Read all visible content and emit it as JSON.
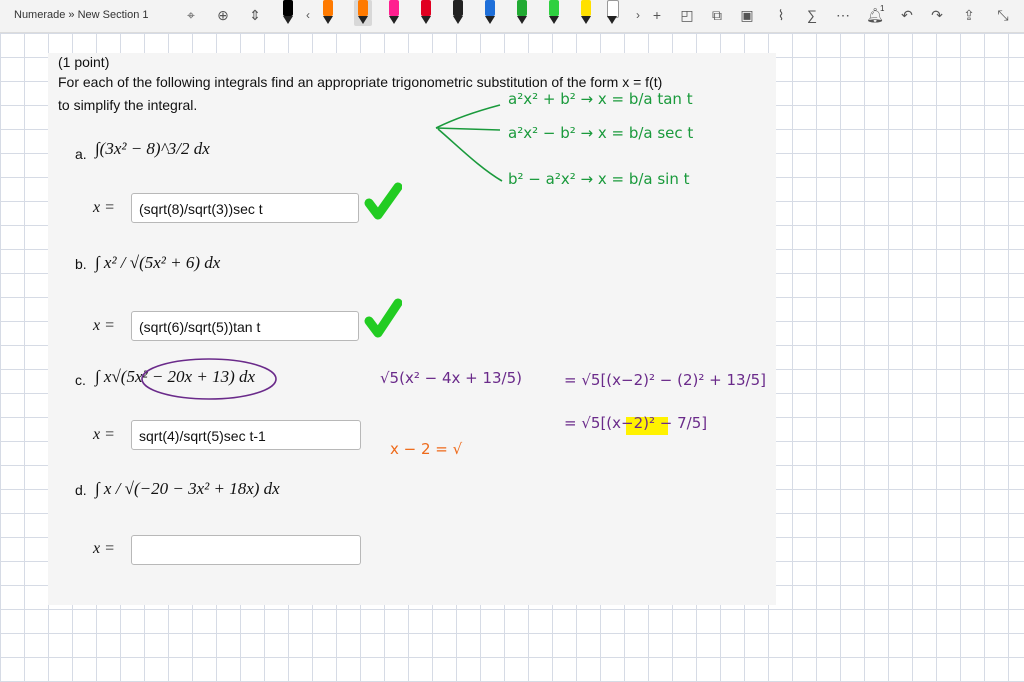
{
  "toolbar": {
    "title": "Numerade » New Section 1",
    "icons": [
      "lasso-icon",
      "add-space-icon",
      "insert-space-icon",
      "back-icon",
      "forward-icon",
      "add-pen-icon",
      "shape-icon",
      "copy-icon",
      "image-icon",
      "ruler-icon",
      "math-icon",
      "more-icon",
      "notification-icon",
      "undo-icon",
      "redo-icon",
      "share-icon",
      "fullscreen-icon"
    ],
    "pen_colors": [
      "#000000",
      "#ff7a00",
      "#ff1f8f",
      "#e00020",
      "#222222",
      "#1e6fd9",
      "#22aa33",
      "#2fd040",
      "#ffe000",
      "#ffffff",
      "#8a2be2",
      "#ff7a00"
    ],
    "notification_count": "1"
  },
  "problem": {
    "points": "(1 point)",
    "instruction_line1": "For each of the following integrals find an appropriate trigonometric substitution of the form x = f(t)",
    "instruction_line2": "to simplify the integral.",
    "parts": [
      {
        "letter": "a.",
        "integral": "∫(3x² − 8)^3/2 dx",
        "label": "x =",
        "answer": "(sqrt(8)/sqrt(3))sec t",
        "correct": true
      },
      {
        "letter": "b.",
        "integral": "∫ x² / √(5x² + 6) dx",
        "label": "x =",
        "answer": "(sqrt(6)/sqrt(5))tan t",
        "correct": true
      },
      {
        "letter": "c.",
        "integral": "∫ x√(5x² − 20x + 13) dx",
        "label": "x =",
        "answer": "sqrt(4)/sqrt(5)sec t-1",
        "correct": null
      },
      {
        "letter": "d.",
        "integral": "∫ x / √(−20 − 3x² + 18x) dx",
        "label": "x =",
        "answer": "",
        "correct": null
      }
    ]
  },
  "annotations": {
    "green_notes": [
      "a²x² + b²  →  x = b/a tan t",
      "a²x² − b²  →  x = b/a sec t",
      "b² − a²x²  →  x = b/a sin t"
    ],
    "purple_notes": [
      "√5(x² − 4x + 13/5)",
      "= √5[(x−2)² − (2)² + 13/5]",
      "= √5[(x−2)² − 7/5]"
    ],
    "orange_note": "x − 2 = √",
    "colors": {
      "green": "#1a9a3c",
      "purple": "#6a2a8a",
      "orange": "#ee6a1a",
      "highlight": "#fff200",
      "check": "#22cc22"
    }
  }
}
